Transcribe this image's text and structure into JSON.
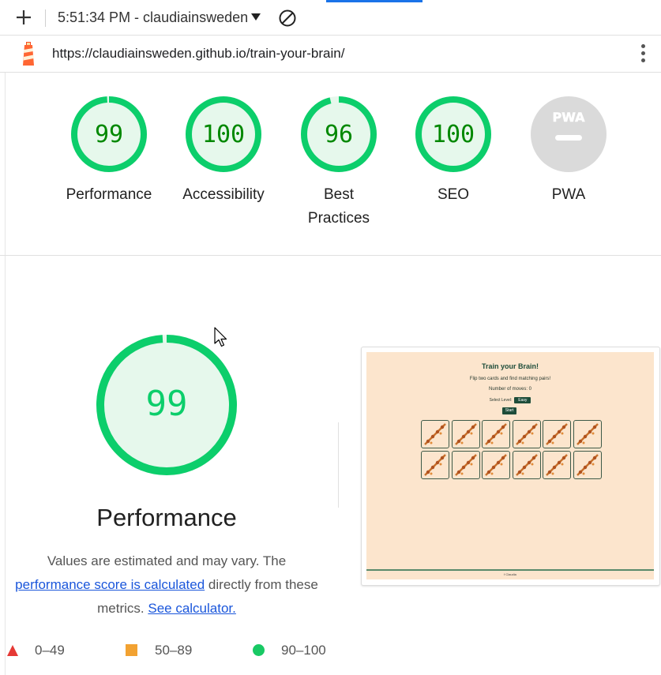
{
  "browser": {
    "timestamp_tab": "5:51:34 PM - claudiainsweden.github.io",
    "url": "https://claudiainsweden.github.io/train-your-brain/",
    "icons": [
      "plus-icon",
      "caret-down-icon",
      "block-icon",
      "lighthouse-icon",
      "kebab-menu-icon"
    ]
  },
  "scores": [
    {
      "label": "Performance",
      "value": "99",
      "fraction": 0.99
    },
    {
      "label": "Accessibility",
      "value": "100",
      "fraction": 1.0
    },
    {
      "label": "Best\nPractices",
      "value": "96",
      "fraction": 0.96
    },
    {
      "label": "SEO",
      "value": "100",
      "fraction": 1.0
    },
    {
      "label": "PWA",
      "value": "",
      "badge_text": "PWA",
      "fraction": 0
    }
  ],
  "performance": {
    "score": "99",
    "fraction": 0.99,
    "title": "Performance",
    "desc_1": "Values are estimated and may vary. The",
    "link_score": "performance score is calculated",
    "desc_2": "directly from these metrics.",
    "link_calc": "See calculator."
  },
  "legend": [
    {
      "range": "0–49",
      "shape": "triangle",
      "color": "#e53935"
    },
    {
      "range": "50–89",
      "shape": "square",
      "color": "#f2a232"
    },
    {
      "range": "90–100",
      "shape": "circle",
      "color": "#18c964"
    }
  ],
  "colors": {
    "pass": "#0cce6b",
    "pass_text": "#008800",
    "pass_fill": "#e6f8ec",
    "pwa_gray": "#dadada"
  },
  "screenshot": {
    "title": "Train your Brain!",
    "subtitle": "Flip two cards and find matching pairs!",
    "moves": "Number of moves: 0",
    "level_label": "Select Level:",
    "level_value": "Easy",
    "start_label": "Start",
    "footer_text": "f Claudia"
  }
}
